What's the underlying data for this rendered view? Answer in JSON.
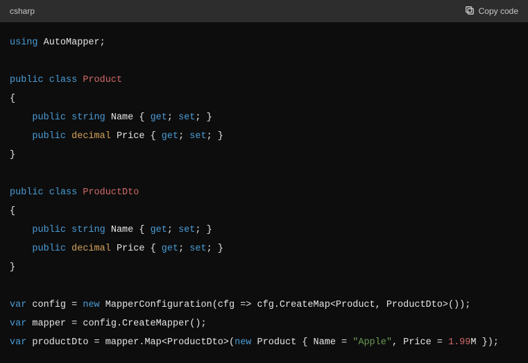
{
  "header": {
    "language": "csharp",
    "copy_label": "Copy code"
  },
  "code": {
    "l1_using": "using",
    "l1_ns": "AutoMapper",
    "l3_public": "public",
    "l3_class": "class",
    "l3_name": "Product",
    "l5_public": "public",
    "l5_type": "string",
    "l5_prop": "Name",
    "l5_get": "get",
    "l5_set": "set",
    "l6_public": "public",
    "l6_type": "decimal",
    "l6_prop": "Price",
    "l6_get": "get",
    "l6_set": "set",
    "l9_public": "public",
    "l9_class": "class",
    "l9_name": "ProductDto",
    "l11_public": "public",
    "l11_type": "string",
    "l11_prop": "Name",
    "l11_get": "get",
    "l11_set": "set",
    "l12_public": "public",
    "l12_type": "decimal",
    "l12_prop": "Price",
    "l12_get": "get",
    "l12_set": "set",
    "l15_var": "var",
    "l15_id": "config",
    "l15_new": "new",
    "l15_rest": "MapperConfiguration(cfg => cfg.CreateMap<Product, ProductDto>());",
    "l16_var": "var",
    "l16_id": "mapper",
    "l16_rest": "config.CreateMapper();",
    "l17_var": "var",
    "l17_id": "productDto",
    "l17_map": "mapper.Map<ProductDto>(",
    "l17_new": "new",
    "l17_prod": "Product { Name = ",
    "l17_str": "\"Apple\"",
    "l17_price": ", Price = ",
    "l17_num": "1.99",
    "l17_suffix": "M",
    "l17_end": " });"
  }
}
